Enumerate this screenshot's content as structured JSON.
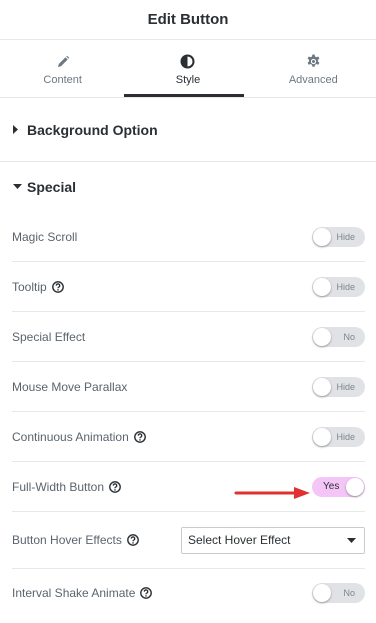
{
  "header": {
    "title": "Edit Button"
  },
  "tabs": [
    {
      "label": "Content",
      "icon": "pencil-icon",
      "active": false
    },
    {
      "label": "Style",
      "icon": "half-circle-icon",
      "active": true
    },
    {
      "label": "Advanced",
      "icon": "gear-icon",
      "active": false
    }
  ],
  "sections": {
    "background": {
      "title": "Background Option",
      "collapsed": true
    },
    "special": {
      "title": "Special",
      "collapsed": false
    }
  },
  "controls": [
    {
      "label": "Magic Scroll",
      "help": false,
      "type": "switch",
      "state": "Hide"
    },
    {
      "label": "Tooltip",
      "help": true,
      "type": "switch",
      "state": "Hide"
    },
    {
      "label": "Special Effect",
      "help": false,
      "type": "switch",
      "state": "No"
    },
    {
      "label": "Mouse Move Parallax",
      "help": false,
      "type": "switch",
      "state": "Hide"
    },
    {
      "label": "Continuous Animation",
      "help": true,
      "type": "switch",
      "state": "Hide"
    },
    {
      "label": "Full-Width Button",
      "help": true,
      "type": "switch",
      "state": "Yes",
      "on": true
    },
    {
      "label": "Button Hover Effects",
      "help": true,
      "type": "select",
      "value": "Select Hover Effect"
    },
    {
      "label": "Interval Shake Animate",
      "help": true,
      "type": "switch",
      "state": "No"
    }
  ],
  "colors": {
    "toggle_on": "#f4c6f7",
    "toggle_off": "#e0e2e5",
    "annotation_arrow": "#e0302f"
  }
}
